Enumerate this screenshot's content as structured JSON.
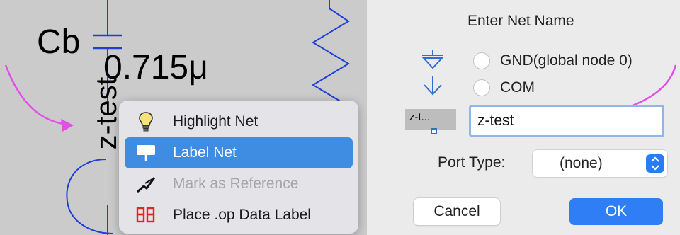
{
  "schematic": {
    "component_name": "Cb",
    "component_value": "0.715μ",
    "net_label": "z-test"
  },
  "context_menu": {
    "items": [
      {
        "label": "Highlight Net",
        "icon": "lightbulb-icon",
        "state": "normal"
      },
      {
        "label": "Label Net",
        "icon": "label-tag-icon",
        "state": "selected"
      },
      {
        "label": "Mark as Reference",
        "icon": "probe-icon",
        "state": "disabled"
      },
      {
        "label": "Place .op Data Label",
        "icon": "seven-segment-icon",
        "state": "normal"
      }
    ]
  },
  "dialog": {
    "title": "Enter Net Name",
    "options": [
      {
        "label": "GND(global node 0)",
        "icon": "ground-icon"
      },
      {
        "label": "COM",
        "icon": "common-arrow-icon"
      }
    ],
    "net_preview": "z-t...",
    "net_name_value": "z-test",
    "port_type_label": "Port Type:",
    "port_type_value": "(none)",
    "cancel_label": "Cancel",
    "ok_label": "OK"
  },
  "colors": {
    "schematic_background": "#cbcbcb",
    "wire": "#1f3fd8",
    "annotation_arrow": "#e14fe6",
    "menu_highlight": "#3f8ce3",
    "accent_blue": "#2f7ef5"
  }
}
